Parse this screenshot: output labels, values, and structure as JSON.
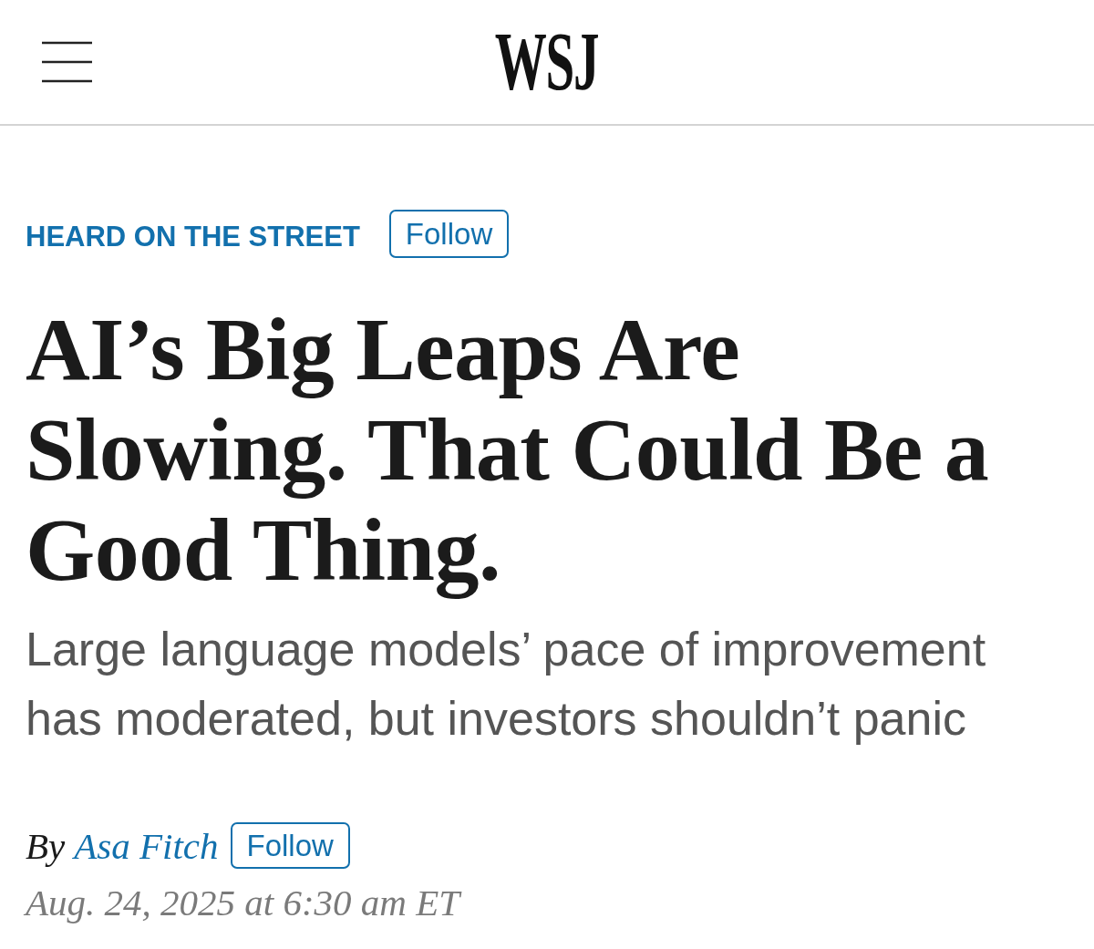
{
  "header": {
    "logo": "WSJ"
  },
  "section": {
    "label": "HEARD ON THE STREET",
    "follow": "Follow"
  },
  "headline": "AI’s Big Leaps Are Slowing. That Could Be a Good Thing.",
  "dek": "Large language models’ pace of improvement has moderated, but investors shouldn’t panic",
  "byline": {
    "prefix": "By",
    "author": "Asa Fitch",
    "follow": "Follow"
  },
  "timestamp": "Aug. 24, 2025 at 6:30 am ET"
}
